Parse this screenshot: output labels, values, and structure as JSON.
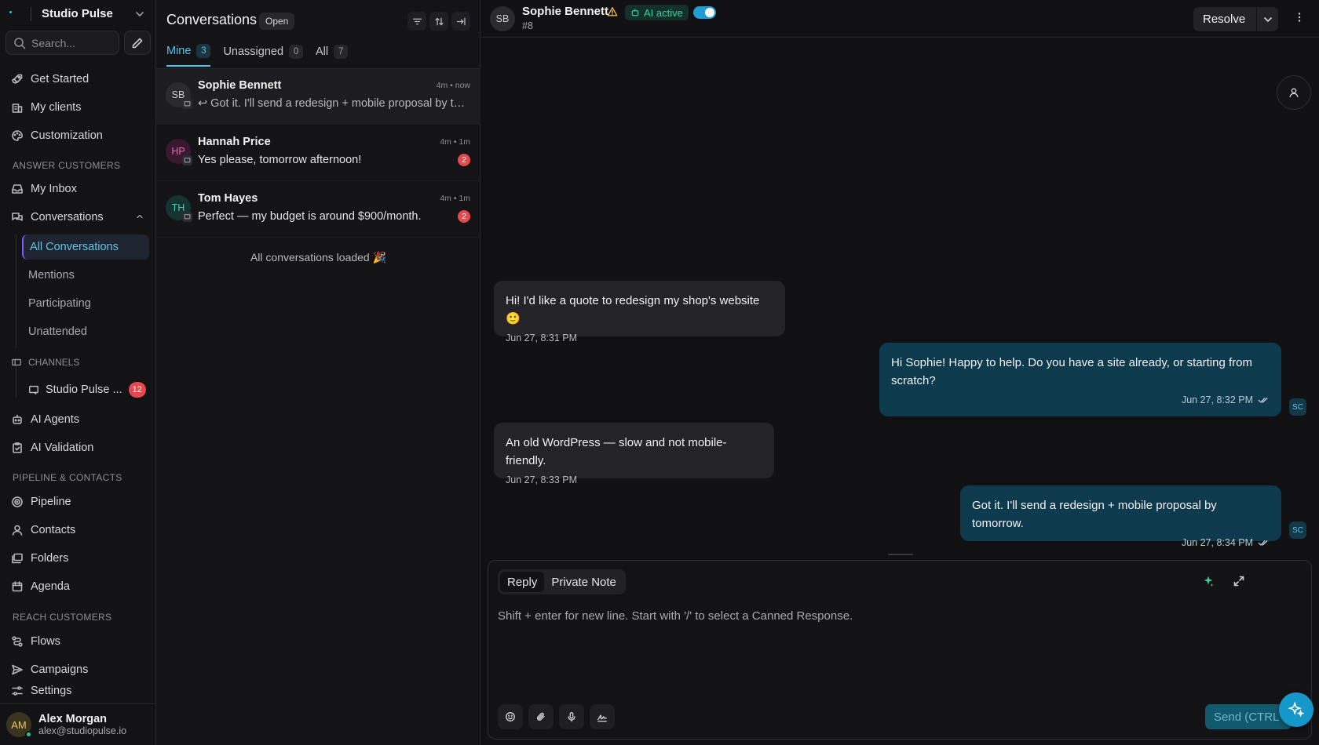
{
  "workspace": {
    "name": "Studio Pulse"
  },
  "search": {
    "placeholder": "Search..."
  },
  "nav": {
    "top": [
      {
        "label": "Get Started",
        "icon": "rocket-icon"
      },
      {
        "label": "My clients",
        "icon": "building-icon"
      },
      {
        "label": "Customization",
        "icon": "palette-icon"
      }
    ],
    "answer_section": "ANSWER CUSTOMERS",
    "my_inbox": "My Inbox",
    "conversations": "Conversations",
    "conversation_subs": [
      "All Conversations",
      "Mentions",
      "Participating",
      "Unattended"
    ],
    "channels_section": "CHANNELS",
    "channel": {
      "label": "Studio Pulse ...",
      "count": "12"
    },
    "ai_agents": "AI Agents",
    "ai_validation": "AI Validation",
    "pipeline_section": "PIPELINE & CONTACTS",
    "pipeline": "Pipeline",
    "contacts": "Contacts",
    "folders": "Folders",
    "agenda": "Agenda",
    "reach_section": "REACH CUSTOMERS",
    "flows": "Flows",
    "campaigns": "Campaigns",
    "settings": "Settings"
  },
  "user": {
    "initials": "AM",
    "name": "Alex Morgan",
    "email": "alex@studiopulse.io"
  },
  "conv_list": {
    "title": "Conversations",
    "status_filter": "Open",
    "tabs": [
      {
        "label": "Mine",
        "count": "3"
      },
      {
        "label": "Unassigned",
        "count": "0"
      },
      {
        "label": "All",
        "count": "7"
      }
    ],
    "items": [
      {
        "initials": "SB",
        "name": "Sophie Bennett",
        "time": "4m • now",
        "preview": "↩ Got it. I'll send a redesign + mobile proposal by tomorrow.",
        "unread": ""
      },
      {
        "initials": "HP",
        "name": "Hannah Price",
        "time": "4m • 1m",
        "preview": "Yes please, tomorrow afternoon!",
        "unread": "2"
      },
      {
        "initials": "TH",
        "name": "Tom Hayes",
        "time": "4m • 1m",
        "preview": "Perfect — my budget is around $900/month.",
        "unread": "2"
      }
    ],
    "footer": "All conversations loaded 🎉"
  },
  "chat": {
    "contact_initials": "SB",
    "contact_name": "Sophie Bennett",
    "conversation_id": "#8",
    "ai_status": "AI active",
    "ai_toggle_on": true,
    "resolve_label": "Resolve",
    "messages": [
      {
        "direction": "in",
        "text": "Hi! I'd like a quote to redesign my shop's website 🙂",
        "time": "Jun 27, 8:31 PM"
      },
      {
        "direction": "out",
        "text": "Hi Sophie! Happy to help. Do you have a site already, or starting from scratch?",
        "time": "Jun 27, 8:32 PM",
        "agent": "SC"
      },
      {
        "direction": "in",
        "text": "An old WordPress — slow and not mobile-friendly.",
        "time": "Jun 27, 8:33 PM"
      },
      {
        "direction": "out",
        "text": "Got it. I'll send a redesign + mobile proposal by tomorrow.",
        "time": "Jun 27, 8:34 PM",
        "agent": "SC"
      }
    ],
    "composer": {
      "modes": [
        "Reply",
        "Private Note"
      ],
      "active_mode": "Reply",
      "placeholder": "Shift + enter for new line. Start with '/' to select a Canned Response.",
      "send_label": "Send (CTRL + ⏎)"
    }
  },
  "colors": {
    "accent": "#4fc3f0",
    "ai_green": "#38d19a",
    "unread_red": "#e5484d",
    "outgoing_bubble": "#0e3a4d",
    "incoming_bubble": "#242428"
  }
}
